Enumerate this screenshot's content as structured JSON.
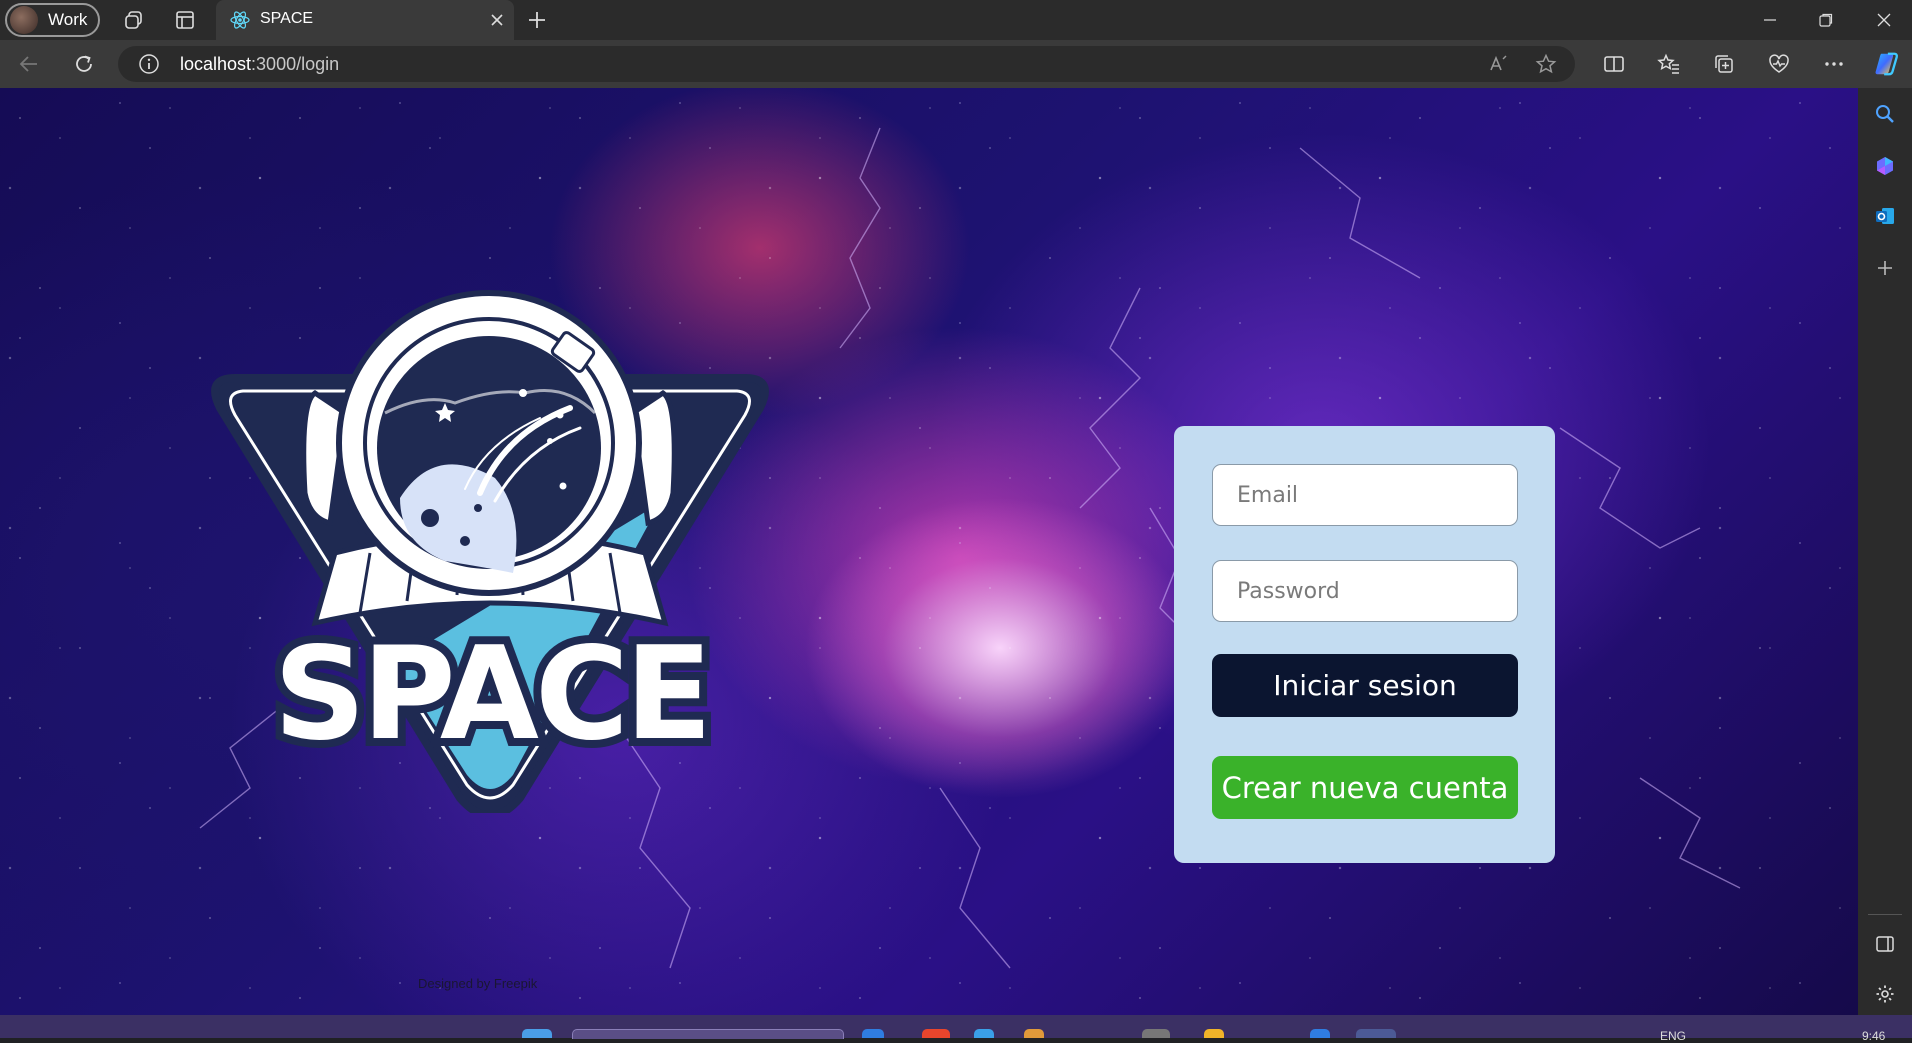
{
  "browser": {
    "profile_label": "Work",
    "tab_title": "SPACE",
    "url_host": "localhost",
    "url_path": ":3000/login"
  },
  "page": {
    "logo_text": "SPACE",
    "credit_text": "Designed by Freepik",
    "login": {
      "email_placeholder": "Email",
      "password_placeholder": "Password",
      "login_button": "Iniciar sesion",
      "register_button": "Crear nueva cuenta"
    }
  },
  "taskbar": {
    "language": "ENG",
    "clock": "9:46"
  },
  "colors": {
    "card_bg": "#c3dcf1",
    "login_button": "#0b1530",
    "register_button": "#3ab22a",
    "logo_navy": "#1f2a52",
    "logo_cyan": "#5bbfe0"
  },
  "icons": [
    "workspaces-icon",
    "tab-actions-icon",
    "react-favicon-icon",
    "close-icon",
    "new-tab-icon",
    "minimize-icon",
    "restore-icon",
    "window-close-icon",
    "back-icon",
    "refresh-icon",
    "info-icon",
    "read-aloud-icon",
    "favorite-star-icon",
    "split-screen-icon",
    "favorites-icon",
    "collections-icon",
    "browser-essentials-icon",
    "more-icon",
    "copilot-icon",
    "search-icon",
    "shopping-icon",
    "outlook-icon",
    "add-icon",
    "sidebar-toggle-icon",
    "settings-icon"
  ]
}
